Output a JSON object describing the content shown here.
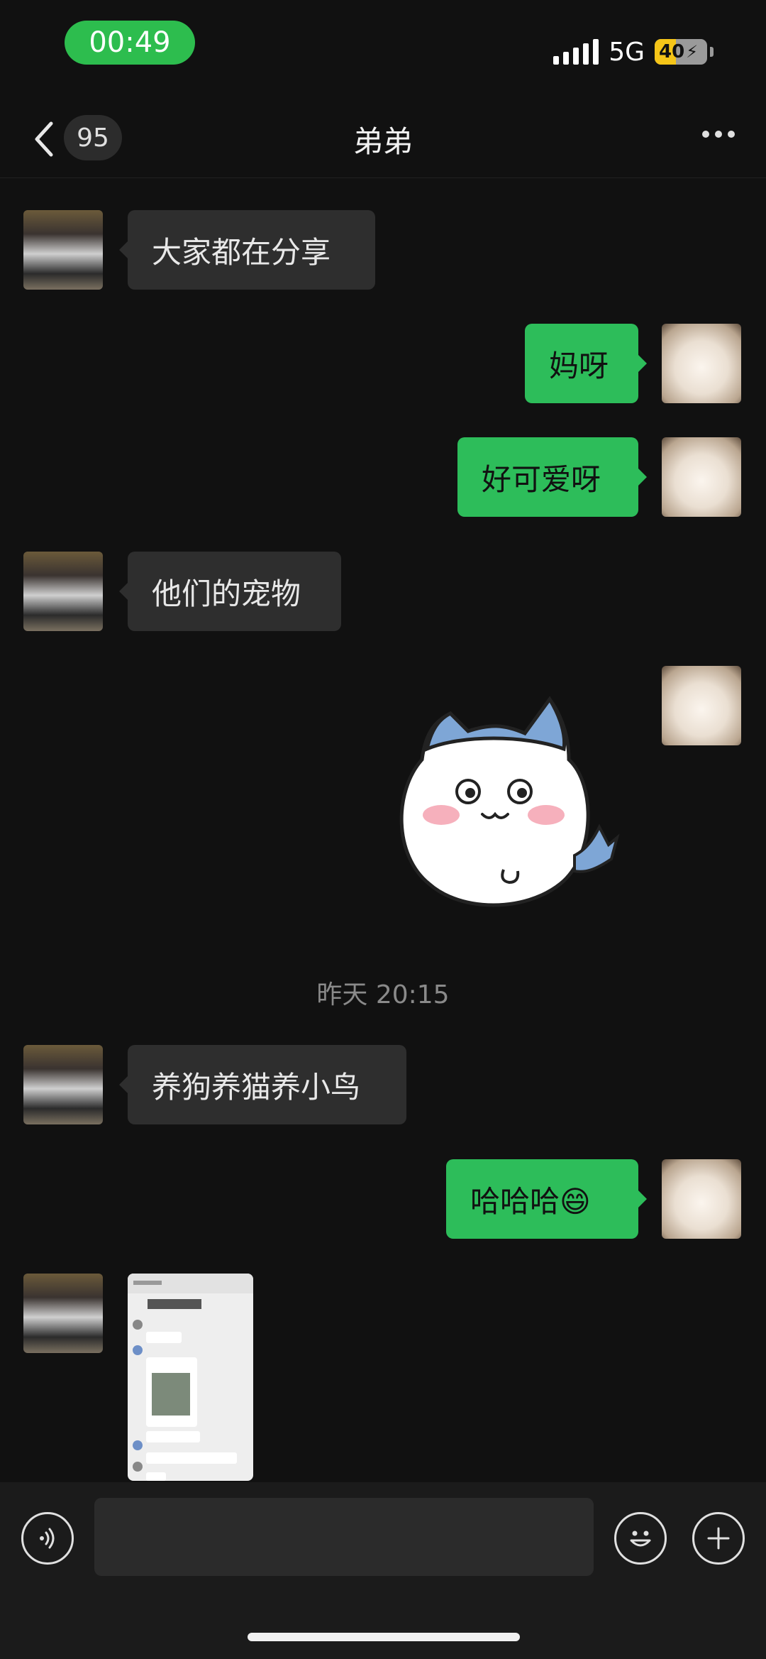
{
  "status_bar": {
    "time": "00:49",
    "network": "5G",
    "battery": "40"
  },
  "nav": {
    "unread_count": "95",
    "title": "弟弟"
  },
  "messages": [
    {
      "side": "in",
      "text": "大家都在分享"
    },
    {
      "side": "out",
      "text": "妈呀"
    },
    {
      "side": "out",
      "text": "好可爱呀"
    },
    {
      "side": "in",
      "text": "他们的宠物"
    },
    {
      "side": "in",
      "text": "养狗养猫养小鸟"
    },
    {
      "side": "out",
      "text": "哈哈哈😄"
    }
  ],
  "timestamp": "昨天 20:15",
  "colors": {
    "accent": "#2dbd5a",
    "background": "#111111",
    "incoming_bubble": "#2e2e2e"
  },
  "icons": {
    "voice": "voice-icon",
    "emoji": "emoji-icon",
    "more": "plus-icon"
  }
}
